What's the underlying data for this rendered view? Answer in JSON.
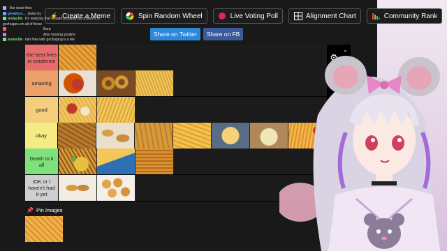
{
  "toolbar": {
    "buttons": [
      {
        "label": "Create a Meme",
        "icon": "lightning-icon"
      },
      {
        "label": "Spin Random Wheel",
        "icon": "wheel-icon"
      },
      {
        "label": "Live Voting Poll",
        "icon": "record-icon"
      },
      {
        "label": "Alignment Chart",
        "icon": "grid-icon"
      },
      {
        "label": "Community Rank",
        "icon": "bars-icon"
      }
    ]
  },
  "share": {
    "twitter": "Share on Twitter",
    "facebook": "Share on FB"
  },
  "chat": {
    "messages": [
      {
        "user": "",
        "text": "like steak fries",
        "color": "#c9a3ff"
      },
      {
        "user": "greathun...",
        "text": "Gotta try",
        "color": "#5fa8ff"
      },
      {
        "user": "tentacl0s",
        "text": "I'm realizing that I would probably put a bunch of gochugaru on all of these",
        "color": "#7be37b"
      },
      {
        "user": "",
        "text": "Burp",
        "color": "#ff5a5a"
      },
      {
        "user": "",
        "text": "Also missing poutine",
        "color": "#e066ff"
      },
      {
        "user": "tentacl0s",
        "text": "nah fries with gochujang is a tier",
        "color": "#7be37b"
      }
    ]
  },
  "tiers": [
    {
      "label": "the best fries in existence",
      "color": "#e86c6c",
      "images": [
        "waffle-fries"
      ]
    },
    {
      "label": "amazing",
      "color": "#eba06b",
      "images": [
        "curly-fries",
        "onion-rings",
        "shoestring-fries"
      ]
    },
    {
      "label": "good",
      "color": "#f4cd7d",
      "images": [
        "fries-with-sauces",
        "crinkle-fries"
      ]
    },
    {
      "label": "okay",
      "color": "#f4ec82",
      "images": [
        "seasoned-wedges",
        "potato-wedges",
        "steak-fries",
        "crinkle-cut-fries",
        "fries-in-basket",
        "poutine-fries",
        "fries-with-ketchup"
      ]
    },
    {
      "label": "Death to it all",
      "color": "#7ee17c",
      "images": [
        "loaded-fries",
        "fries-in-cone",
        "twister-fries"
      ]
    },
    {
      "label": "IDK or I haven't had it yet",
      "color": "#cfcfcf",
      "images": [
        "tater-tots",
        "smiley-fries"
      ]
    }
  ],
  "pin": {
    "label": "Pin Images",
    "images": [
      "waffle-fries-pinned"
    ]
  },
  "colors": {
    "background": "#191919",
    "share_twitter": "#2d88d8",
    "share_fb": "#3b5a9a",
    "accent_pink": "#d0598d"
  }
}
